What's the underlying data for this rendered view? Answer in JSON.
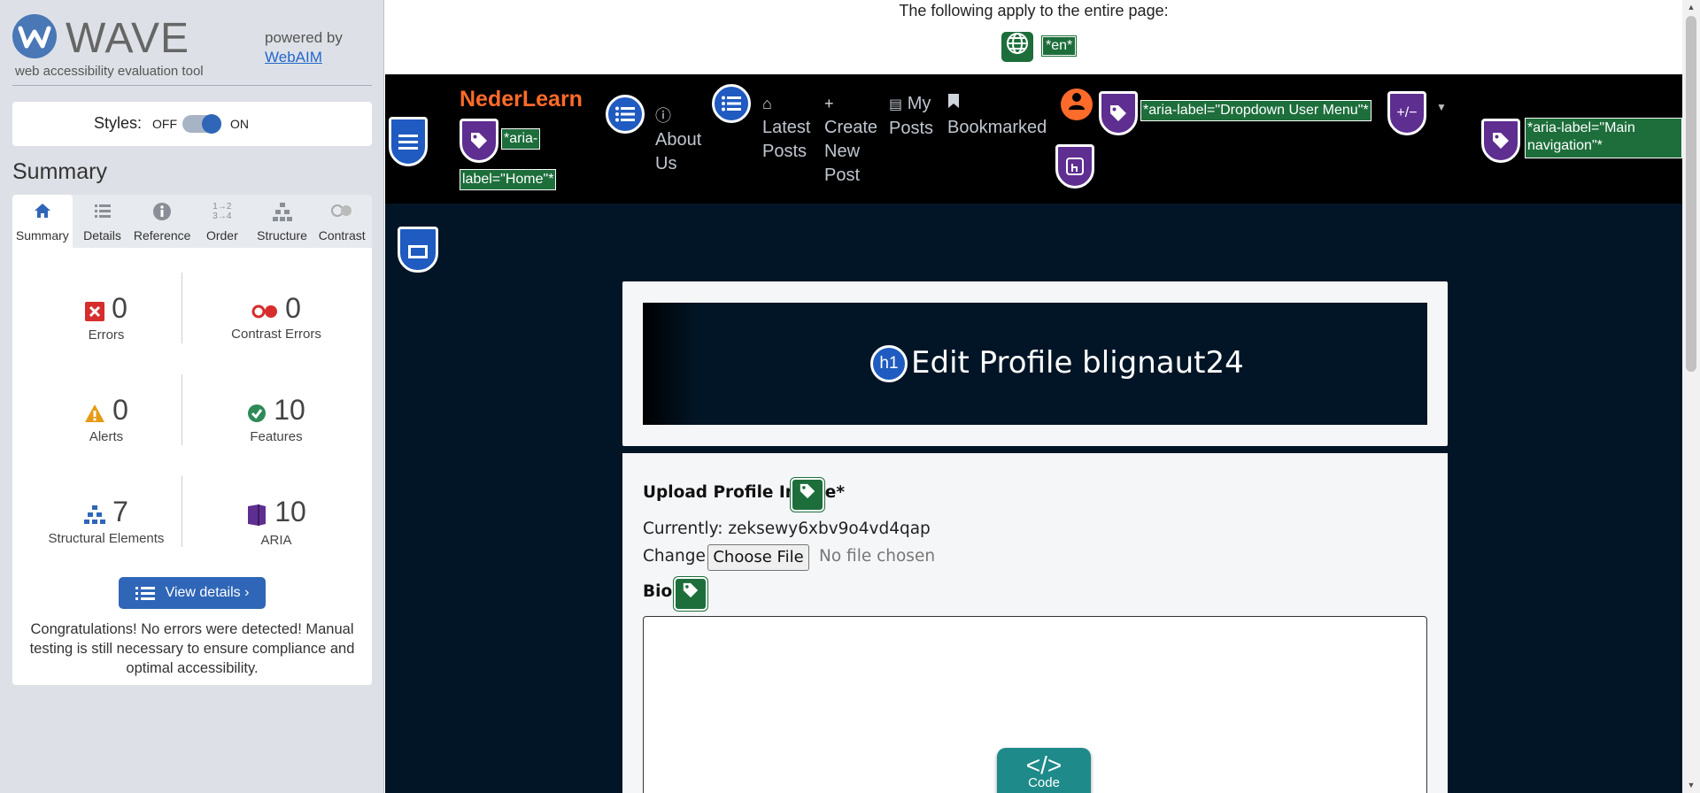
{
  "wave": {
    "logo_word": "WAVE",
    "tagline": "web accessibility evaluation tool",
    "powered_by": "powered by",
    "webaim_link": "WebAIM",
    "styles_label": "Styles:",
    "styles_off": "OFF",
    "styles_on": "ON",
    "summary_heading": "Summary",
    "tabs": [
      {
        "label": "Summary",
        "icon": "home-icon"
      },
      {
        "label": "Details",
        "icon": "list-icon"
      },
      {
        "label": "Reference",
        "icon": "info-icon"
      },
      {
        "label": "Order",
        "icon": "order-icon"
      },
      {
        "label": "Structure",
        "icon": "structure-icon"
      },
      {
        "label": "Contrast",
        "icon": "contrast-icon"
      }
    ],
    "stats": {
      "errors": {
        "value": "0",
        "label": "Errors"
      },
      "contrast_errors": {
        "value": "0",
        "label": "Contrast Errors"
      },
      "alerts": {
        "value": "0",
        "label": "Alerts"
      },
      "features": {
        "value": "10",
        "label": "Features"
      },
      "structural": {
        "value": "7",
        "label": "Structural Elements"
      },
      "aria": {
        "value": "10",
        "label": "ARIA"
      }
    },
    "view_details": "View details ›",
    "congrats": "Congratulations! No errors were detected! Manual testing is still necessary to ensure compliance and optimal accessibility."
  },
  "page": {
    "apply_text": "The following apply to the entire page:",
    "lang_tag": "*en*",
    "brand": "NederLearn",
    "home_aria_1": "*aria-",
    "home_aria_2": "label=\"Home\"*",
    "nav": {
      "about_1": "About",
      "about_2": "Us",
      "latest_1": "Latest",
      "latest_2": "Posts",
      "create_1": "Create",
      "create_2": "New",
      "create_3": "Post",
      "my_1": "My",
      "my_2": "Posts",
      "bookmarked": "Bookmarked"
    },
    "dropdown_aria": "*aria-label=\"Dropdown User Menu\"*",
    "plusminus": "+/−",
    "main_nav_aria_1": "*aria-label=\"Main",
    "main_nav_aria_2": "navigation\"*",
    "h1_badge": "h1",
    "h1_text": "Edit Profile blignaut24",
    "upload_label": "Upload Profile Image*",
    "currently": "Currently: zeksewy6xbv9o4vd4qap",
    "change": "Change:",
    "choose_file": "Choose File",
    "no_file": "No file chosen",
    "bio_label": "Bio",
    "code_1": "</>",
    "code_2": "Code"
  },
  "colors": {
    "wave_blue": "#2f66b7",
    "navbar_bg": "#000000",
    "page_bg": "#021526",
    "brand_orange": "#ff6b2a",
    "aria_green": "#1d6e3b",
    "aria_purple": "#5e2e90"
  }
}
